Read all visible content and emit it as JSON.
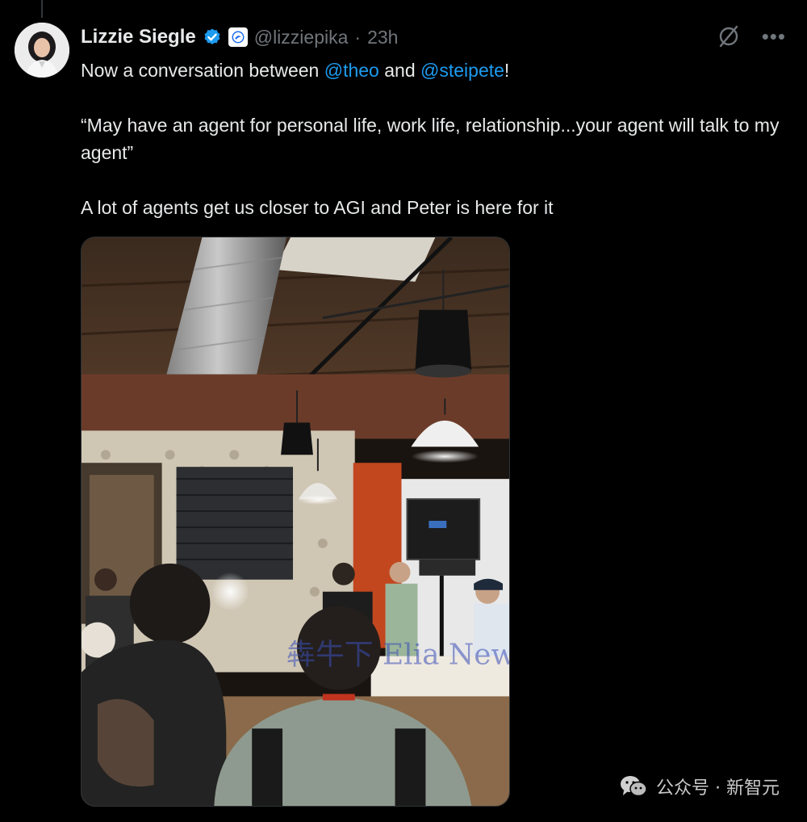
{
  "tweet": {
    "author": {
      "display_name": "Lizzie Siegle",
      "handle": "@lizziepika",
      "time": "23h",
      "separator": "·"
    },
    "text": {
      "line1_prefix": "Now a conversation between ",
      "mention1": "@theo",
      "line1_middle": " and ",
      "mention2": "@steipete",
      "line1_suffix": "!",
      "quote": "“May have an agent for personal life, work life, relationship...your agent will talk to my agent”",
      "closing": "A lot of agents get us closer to AGI and Peter is here for it"
    },
    "media_overlay_text": "犇牛下 Elia News",
    "icons": {
      "verified": "verified-badge-icon",
      "affiliate": "affiliate-badge-icon",
      "grok": "grok-icon",
      "more": "more-icon"
    }
  },
  "watermark": {
    "label": "公众号 · 新智元"
  },
  "colors": {
    "background": "#000000",
    "text": "#e7e9ea",
    "muted": "#71767b",
    "accent": "#1d9bf0"
  }
}
